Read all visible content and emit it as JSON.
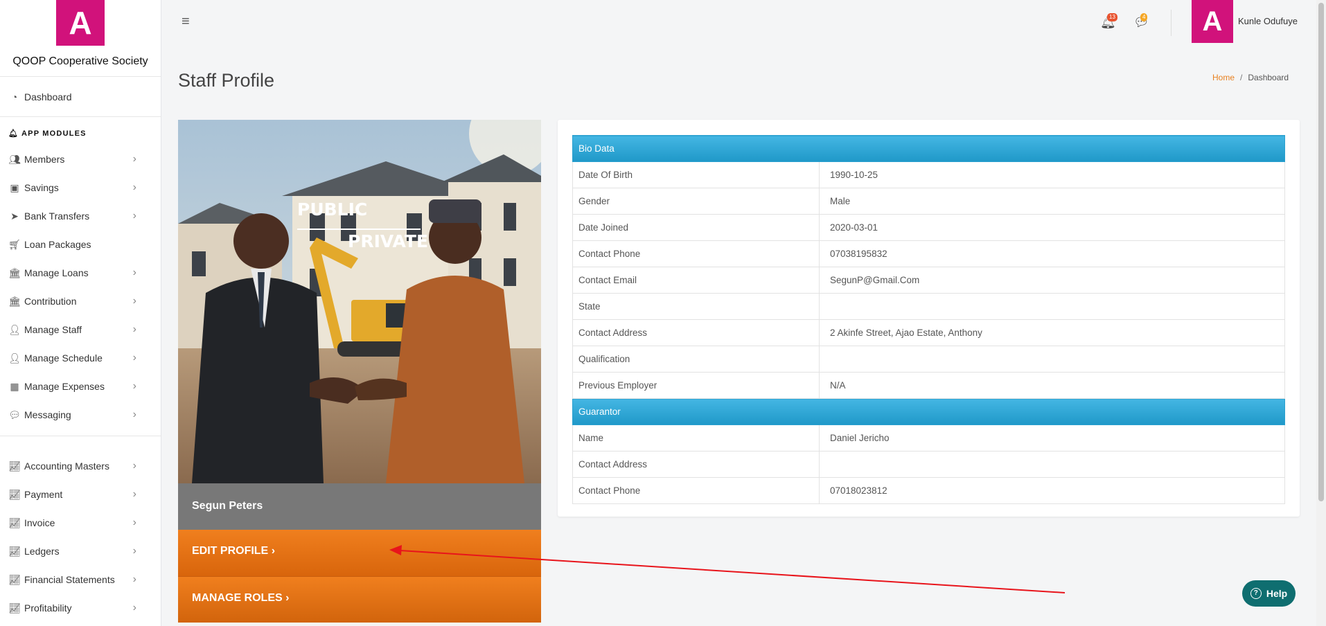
{
  "brand": {
    "logo_letter": "A",
    "name": "QOOP Cooperative Society",
    "color": "#d1127b"
  },
  "sidebar": {
    "dashboard": "Dashboard",
    "section_title": "APP MODULES",
    "items": [
      {
        "label": "Members",
        "icon": "users-icon"
      },
      {
        "label": "Savings",
        "icon": "money-icon"
      },
      {
        "label": "Bank Transfers",
        "icon": "paper-plane-icon"
      },
      {
        "label": "Loan Packages",
        "icon": "cart-icon"
      },
      {
        "label": "Manage Loans",
        "icon": "bank-icon"
      },
      {
        "label": "Contribution",
        "icon": "bank-icon"
      },
      {
        "label": "Manage Staff",
        "icon": "user-icon"
      },
      {
        "label": "Manage Schedule",
        "icon": "user-icon"
      },
      {
        "label": "Manage Expenses",
        "icon": "calculator-icon"
      },
      {
        "label": "Messaging",
        "icon": "comments-icon"
      }
    ],
    "accounting_items": [
      {
        "label": "Accounting Masters",
        "icon": "chart-icon"
      },
      {
        "label": "Payment",
        "icon": "chart-icon"
      },
      {
        "label": "Invoice",
        "icon": "chart-icon"
      },
      {
        "label": "Ledgers",
        "icon": "chart-icon"
      },
      {
        "label": "Financial Statements",
        "icon": "chart-icon"
      },
      {
        "label": "Profitability",
        "icon": "chart-icon"
      }
    ]
  },
  "topbar": {
    "notifications_count": "13",
    "messages_count": "4",
    "avatar_letter": "A",
    "username": "Kunle Odufuye"
  },
  "page": {
    "title": "Staff Profile",
    "breadcrumb": {
      "home": "Home",
      "sep": "/",
      "current": "Dashboard"
    }
  },
  "profile": {
    "name": "Segun Peters",
    "photo_text_line1": "PUBLIC",
    "photo_text_line2": "PRIVATE",
    "edit_label": "EDIT PROFILE",
    "roles_label": "MANAGE ROLES",
    "chevron": "›"
  },
  "bio": {
    "header": "Bio Data",
    "rows": [
      {
        "label": "Date Of Birth",
        "value": "1990-10-25"
      },
      {
        "label": "Gender",
        "value": "Male"
      },
      {
        "label": "Date Joined",
        "value": "2020-03-01"
      },
      {
        "label": "Contact Phone",
        "value": "07038195832"
      },
      {
        "label": "Contact Email",
        "value": "SegunP@Gmail.Com"
      },
      {
        "label": "State",
        "value": ""
      },
      {
        "label": "Contact Address",
        "value": "2 Akinfe Street, Ajao Estate, Anthony"
      },
      {
        "label": "Qualification",
        "value": ""
      },
      {
        "label": "Previous Employer",
        "value": "N/A"
      }
    ],
    "guarantor_header": "Guarantor",
    "guarantor_rows": [
      {
        "label": "Name",
        "value": "Daniel Jericho"
      },
      {
        "label": "Contact Address",
        "value": ""
      },
      {
        "label": "Contact Phone",
        "value": "07018023812"
      }
    ]
  },
  "help": {
    "label": "Help",
    "q": "?"
  }
}
